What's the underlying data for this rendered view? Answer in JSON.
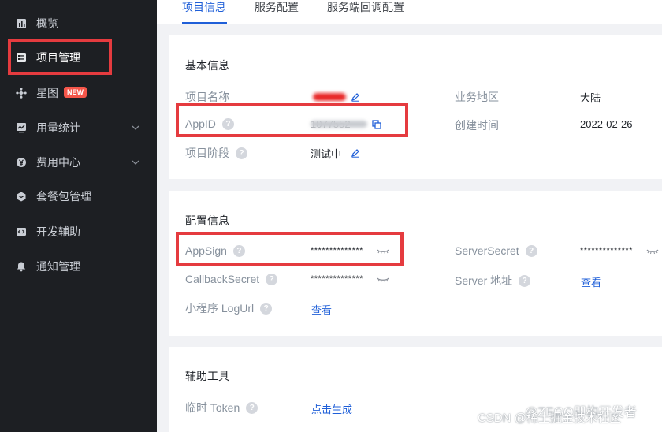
{
  "sidebar": {
    "items": [
      {
        "label": "概览",
        "icon": "bar-chart-icon"
      },
      {
        "label": "项目管理",
        "icon": "project-list-icon"
      },
      {
        "label": "星图",
        "icon": "star-map-icon",
        "badge": "NEW"
      },
      {
        "label": "用量统计",
        "icon": "usage-chart-icon"
      },
      {
        "label": "费用中心",
        "icon": "yuan-icon"
      },
      {
        "label": "套餐包管理",
        "icon": "package-icon"
      },
      {
        "label": "开发辅助",
        "icon": "code-icon"
      },
      {
        "label": "通知管理",
        "icon": "bell-icon"
      }
    ]
  },
  "tabs": [
    "项目信息",
    "服务配置",
    "服务端回调配置"
  ],
  "basic": {
    "title": "基本信息",
    "project_name_label": "项目名称",
    "appid_label": "AppID",
    "appid_value": "1077552",
    "stage_label": "项目阶段",
    "stage_value": "测试中",
    "region_label": "业务地区",
    "region_value": "大陆",
    "created_label": "创建时间",
    "created_value": "2022-02-26"
  },
  "config": {
    "title": "配置信息",
    "appsign_label": "AppSign",
    "appsign_value": "**************",
    "callback_label": "CallbackSecret",
    "callback_value": "**************",
    "logurl_label": "小程序 LogUrl",
    "logurl_link": "查看",
    "server_secret_label": "ServerSecret",
    "server_secret_value": "**************",
    "server_addr_label": "Server 地址",
    "server_addr_link": "查看"
  },
  "tools": {
    "title": "辅助工具",
    "token_label": "临时 Token",
    "token_link": "点击生成"
  },
  "help_glyph": "?",
  "watermark": "CSDN @稀土掘金技术社区",
  "watermark2": "@ZEGO即构开发者",
  "colors": {
    "accent": "#1f5fd8",
    "highlight": "#e53b3f",
    "sidebar_bg": "#1d1f23"
  }
}
